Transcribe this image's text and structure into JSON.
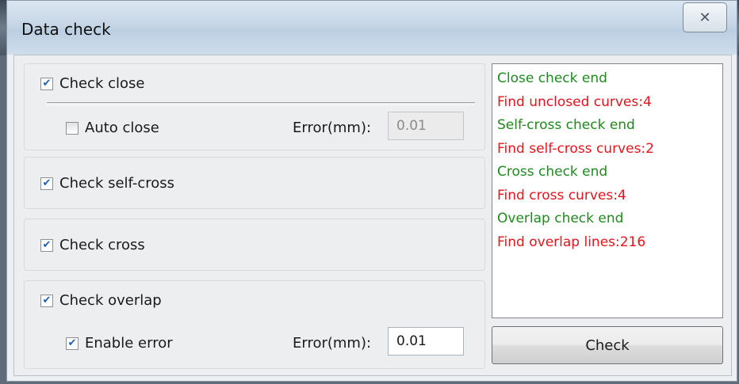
{
  "window": {
    "title": "Data check",
    "close_glyph": "✕"
  },
  "check_close": {
    "label": "Check close",
    "checked": true,
    "auto_close": {
      "label": "Auto close",
      "checked": false
    },
    "error_label": "Error(mm):",
    "error_value": "0.01",
    "error_enabled": false
  },
  "check_self_cross": {
    "label": "Check self-cross",
    "checked": true
  },
  "check_cross": {
    "label": "Check cross",
    "checked": true
  },
  "check_overlap": {
    "label": "Check overlap",
    "checked": true,
    "enable_error": {
      "label": "Enable error",
      "checked": true
    },
    "error_label": "Error(mm):",
    "error_value": "0.01",
    "error_enabled": true
  },
  "log": {
    "lines": [
      {
        "text": "Close check end",
        "color": "#1f8a1f"
      },
      {
        "text": "Find unclosed curves:4",
        "color": "#e8141c"
      },
      {
        "text": "Self-cross check end",
        "color": "#1f8a1f"
      },
      {
        "text": "Find self-cross curves:2",
        "color": "#e8141c"
      },
      {
        "text": "Cross check end",
        "color": "#1f8a1f"
      },
      {
        "text": "Find cross curves:4",
        "color": "#e8141c"
      },
      {
        "text": "Overlap check end",
        "color": "#1f8a1f"
      },
      {
        "text": "Find overlap lines:216",
        "color": "#e8141c"
      }
    ]
  },
  "check_button": {
    "label": "Check"
  }
}
